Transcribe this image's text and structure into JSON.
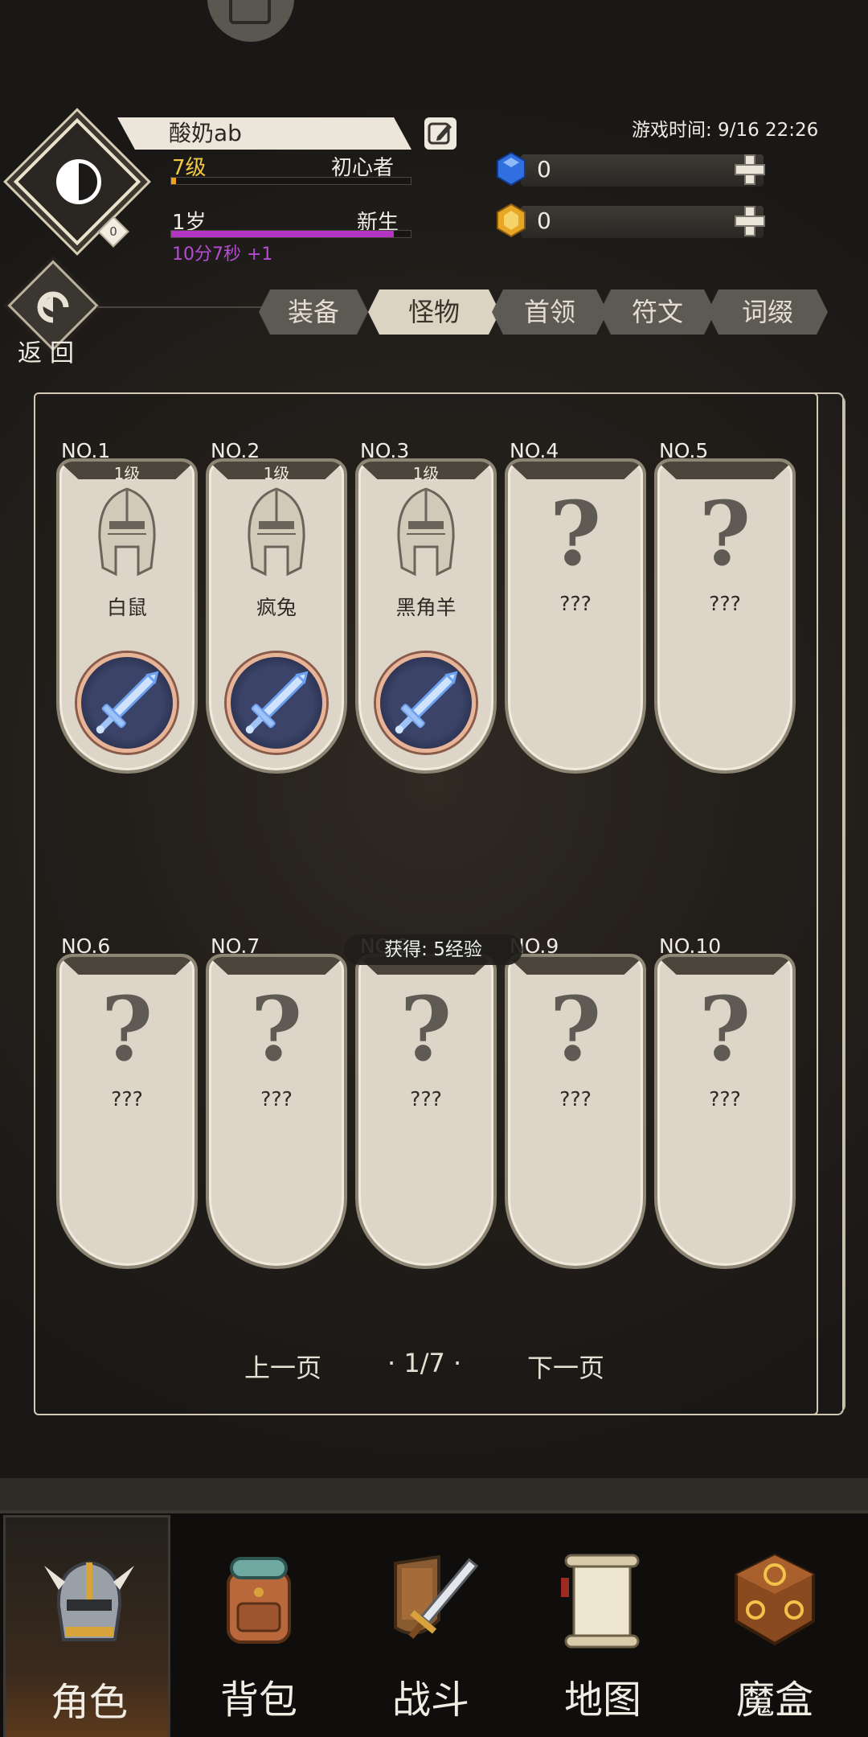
{
  "player": {
    "name": "酸奶ab",
    "level": "7级",
    "title": "初心者",
    "age": "1岁",
    "age_title": "新生",
    "timer": "10分7秒 +1",
    "badge": "0",
    "level_progress": 0.02,
    "age_progress": 0.93
  },
  "game_time": "游戏时间: 9/16 22:26",
  "resources": [
    {
      "name": "blue-gem",
      "value": "0",
      "color": "#2f6fe0"
    },
    {
      "name": "gold-gem",
      "value": "0",
      "color": "#e7a623"
    }
  ],
  "back_label": "返回",
  "tabs": [
    "装备",
    "怪物",
    "首领",
    "符文",
    "词缀"
  ],
  "active_tab": "怪物",
  "cards": [
    {
      "no": "NO.1",
      "level": "1级",
      "name": "白鼠",
      "known": true
    },
    {
      "no": "NO.2",
      "level": "1级",
      "name": "疯兔",
      "known": true
    },
    {
      "no": "NO.3",
      "level": "1级",
      "name": "黑角羊",
      "known": true
    },
    {
      "no": "NO.4",
      "level": "",
      "name": "???",
      "known": false
    },
    {
      "no": "NO.5",
      "level": "",
      "name": "???",
      "known": false
    },
    {
      "no": "NO.6",
      "level": "",
      "name": "???",
      "known": false
    },
    {
      "no": "NO.7",
      "level": "",
      "name": "???",
      "known": false
    },
    {
      "no": "NO.8",
      "level": "",
      "name": "???",
      "known": false
    },
    {
      "no": "NO.9",
      "level": "",
      "name": "???",
      "known": false
    },
    {
      "no": "NO.10",
      "level": "",
      "name": "???",
      "known": false
    }
  ],
  "tooltip": "获得: 5经验",
  "pager": {
    "prev": "上一页",
    "page": "· 1/7 ·",
    "next": "下一页"
  },
  "nav": [
    {
      "label": "角色",
      "icon": "helmet-icon",
      "active": true
    },
    {
      "label": "背包",
      "icon": "backpack-icon",
      "active": false
    },
    {
      "label": "战斗",
      "icon": "sword-shield-icon",
      "active": false
    },
    {
      "label": "地图",
      "icon": "scroll-map-icon",
      "active": false
    },
    {
      "label": "魔盒",
      "icon": "magic-box-icon",
      "active": false
    }
  ]
}
